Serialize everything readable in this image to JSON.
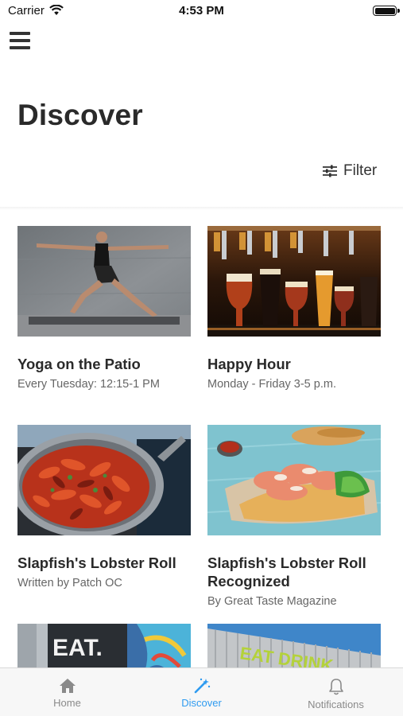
{
  "status_bar": {
    "carrier": "Carrier",
    "time": "4:53 PM"
  },
  "header": {
    "title": "Discover",
    "filter_label": "Filter"
  },
  "cards": [
    {
      "title": "Yoga on the Patio",
      "subtitle": "Every Tuesday: 12:15-1 PM",
      "image": "yoga-photo"
    },
    {
      "title": "Happy Hour",
      "subtitle": "Monday - Friday 3-5 p.m.",
      "image": "beer-taps-photo"
    },
    {
      "title": "Slapfish's Lobster Roll",
      "subtitle": "Written by Patch OC",
      "image": "crawfish-pan-photo"
    },
    {
      "title": "Slapfish's Lobster Roll Recognized",
      "subtitle": "By Great Taste Magazine",
      "image": "lobster-roll-photo"
    },
    {
      "title": "",
      "subtitle": "",
      "image": "eat-sign-photo",
      "sign_text": "EAT."
    },
    {
      "title": "",
      "subtitle": "",
      "image": "eat-drink-building-photo",
      "sign_text": "EAT DRINK"
    }
  ],
  "tab_bar": {
    "tabs": [
      {
        "label": "Home",
        "icon": "home-icon"
      },
      {
        "label": "Discover",
        "icon": "magic-wand-icon"
      },
      {
        "label": "Notifications",
        "icon": "bell-icon"
      }
    ],
    "active_tab": "Discover",
    "active_color": "#2f9bf0",
    "inactive_color": "#8a8a8a"
  }
}
